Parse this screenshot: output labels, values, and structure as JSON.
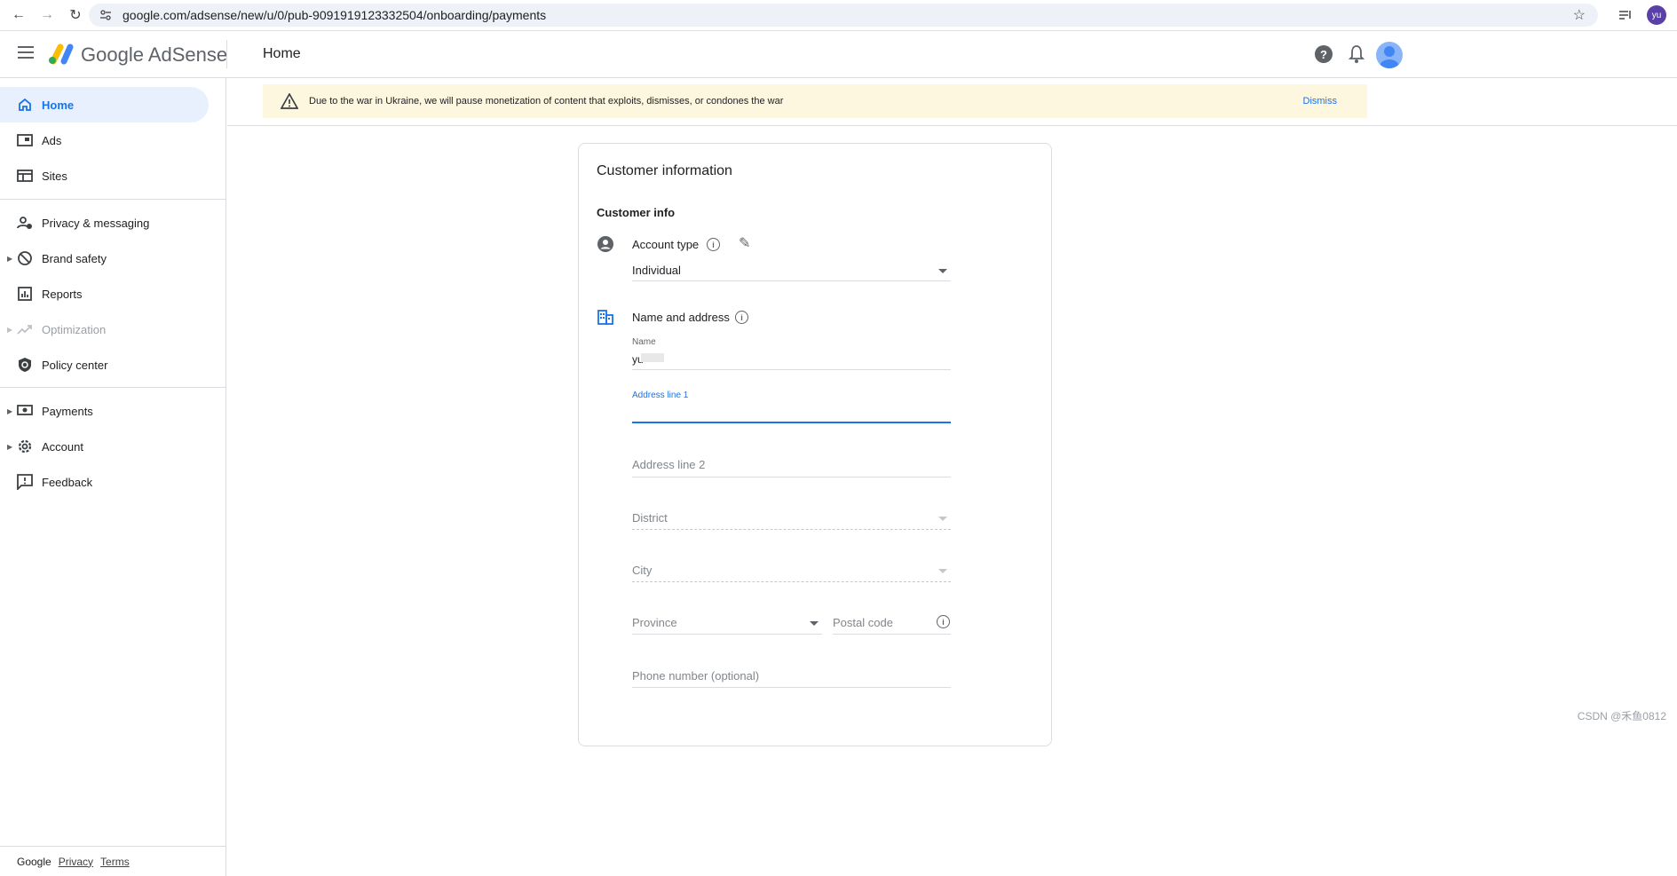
{
  "browser": {
    "url": "google.com/adsense/new/u/0/pub-9091919123332504/onboarding/payments",
    "profile_initials": "yu"
  },
  "header": {
    "brand": "Google AdSense",
    "title": "Home"
  },
  "sidebar": {
    "items": [
      {
        "label": "Home",
        "icon": "home-icon"
      },
      {
        "label": "Ads",
        "icon": "ads-icon"
      },
      {
        "label": "Sites",
        "icon": "sites-icon"
      },
      {
        "label": "Privacy & messaging",
        "icon": "privacy-icon"
      },
      {
        "label": "Brand safety",
        "icon": "block-icon"
      },
      {
        "label": "Reports",
        "icon": "reports-icon"
      },
      {
        "label": "Optimization",
        "icon": "trending-icon"
      },
      {
        "label": "Policy center",
        "icon": "shield-icon"
      },
      {
        "label": "Payments",
        "icon": "payments-icon"
      },
      {
        "label": "Account",
        "icon": "gear-icon"
      },
      {
        "label": "Feedback",
        "icon": "feedback-icon"
      }
    ],
    "footer": {
      "google": "Google",
      "privacy": "Privacy",
      "terms": "Terms"
    }
  },
  "banner": {
    "message": "Due to the war in Ukraine, we will pause monetization of content that exploits, dismisses, or condones the war",
    "dismiss": "Dismiss"
  },
  "card": {
    "title": "Customer information",
    "section": "Customer info",
    "account_type": {
      "label": "Account type",
      "value": "Individual"
    },
    "name_address": {
      "label": "Name and address",
      "name_label": "Name",
      "name_value": "yu",
      "address1_label": "Address line 1",
      "address2_placeholder": "Address line 2",
      "district_placeholder": "District",
      "city_placeholder": "City",
      "province_placeholder": "Province",
      "postal_placeholder": "Postal code",
      "phone_placeholder": "Phone number (optional)"
    }
  },
  "watermark": "CSDN @禾鱼0812",
  "colors": {
    "accent": "#1a73e8",
    "banner_bg": "#fef7e0",
    "active_bg": "#e8f0fe"
  }
}
